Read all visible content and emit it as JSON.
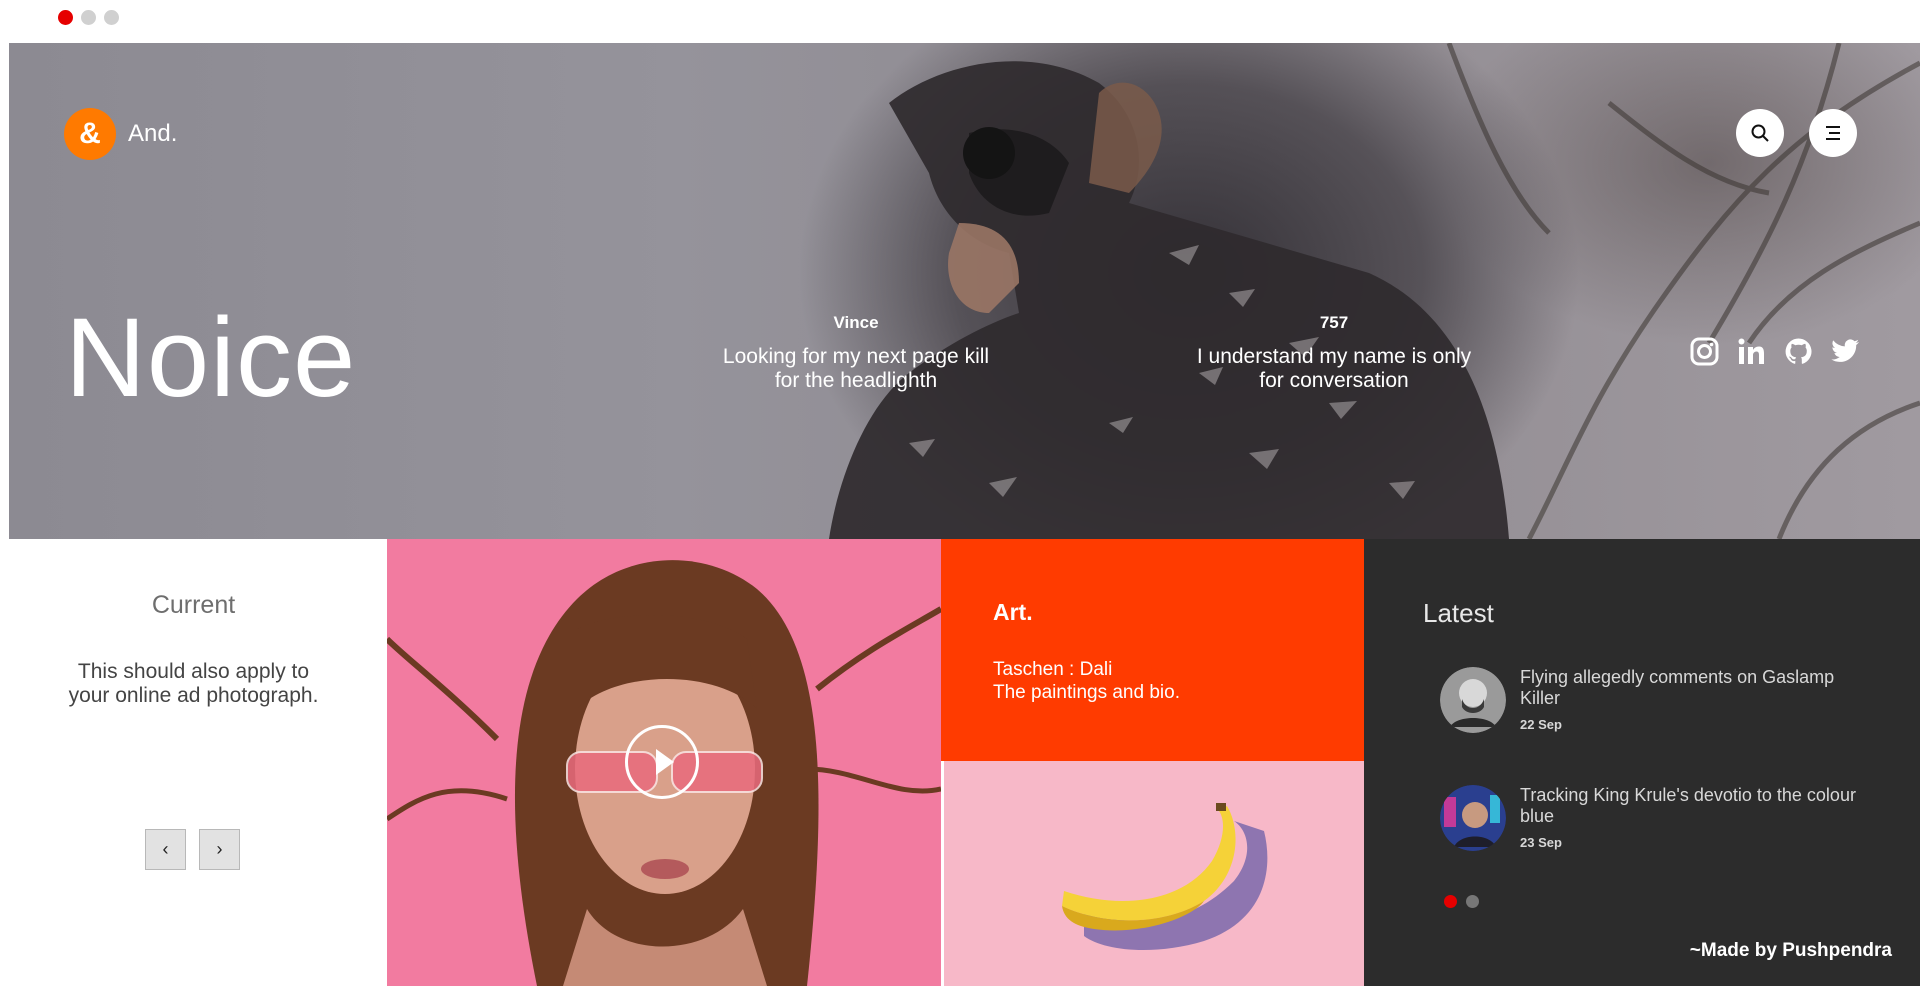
{
  "window": {
    "dots": [
      "close",
      "minimize",
      "maximize"
    ]
  },
  "hero": {
    "brand": {
      "logo": "&",
      "name": "And."
    },
    "title": "Noice",
    "quotes": [
      {
        "who": "Vince",
        "text_line1": "Looking for my next page kill",
        "text_line2": "for the headlighth"
      },
      {
        "who": "757",
        "text_line1": "I understand my name is only",
        "text_line2": "for conversation"
      }
    ],
    "actions": {
      "search_icon": "search-icon",
      "menu_icon": "menu-icon"
    },
    "socials": [
      "instagram-icon",
      "linkedin-icon",
      "github-icon",
      "twitter-icon"
    ]
  },
  "current": {
    "title": "Current",
    "text_line1": "This should also apply to",
    "text_line2": "your online ad photograph.",
    "prev_label": "‹",
    "next_label": "›"
  },
  "art": {
    "title": "Art.",
    "line1": "Taschen : Dali",
    "line2": "The paintings and bio."
  },
  "latest": {
    "title": "Latest",
    "posts": [
      {
        "title": "Flying allegedly comments on Gaslamp Killer",
        "date": "22 Sep"
      },
      {
        "title": "Tracking King Krule's devotio to the colour blue",
        "date": "23 Sep"
      }
    ],
    "pager": {
      "active": 0,
      "count": 2
    },
    "credit": "~Made by Pushpendra"
  },
  "colors": {
    "accent_orange": "#ff7a00",
    "art_red": "#ff3b00",
    "dark_panel": "#2c2c2c",
    "photo_pink": "#f27ba0",
    "banana_pink": "#f7b8c8"
  }
}
